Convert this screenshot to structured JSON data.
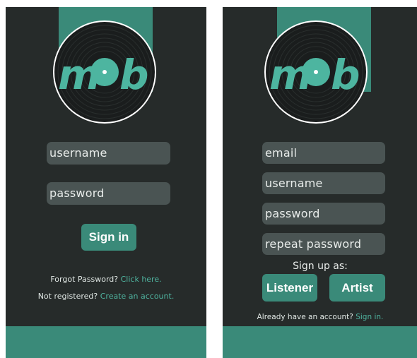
{
  "brand": {
    "logo_text": "mob",
    "accent": "#3a8a79",
    "background": "#262b2a"
  },
  "login": {
    "username_placeholder": "username",
    "password_placeholder": "password",
    "signin_label": "Sign in",
    "forgot_text": "Forgot Password?",
    "forgot_link": "Click here.",
    "notregistered_text": "Not registered?",
    "create_link": "Create an account."
  },
  "signup": {
    "email_placeholder": "email",
    "username_placeholder": "username",
    "password_placeholder": "password",
    "repeat_placeholder": "repeat password",
    "signup_as_label": "Sign up as:",
    "listener_label": "Listener",
    "artist_label": "Artist",
    "already_text": "Already have an account?",
    "signin_link": "Sign in."
  }
}
